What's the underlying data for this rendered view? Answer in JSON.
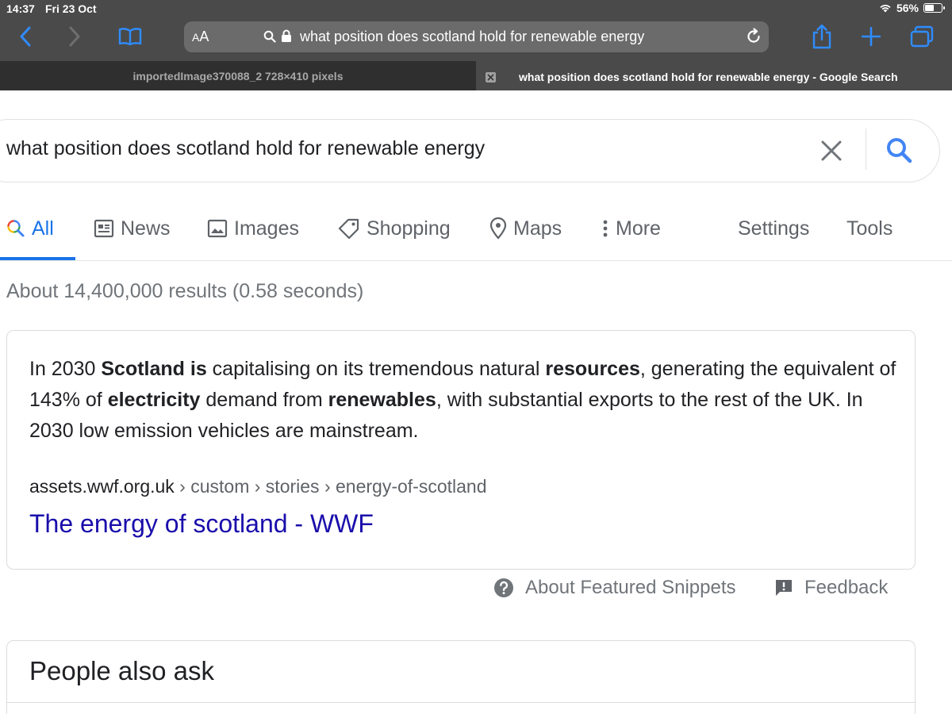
{
  "status": {
    "time": "14:37",
    "date": "Fri 23 Oct",
    "battery": "56%"
  },
  "safari": {
    "text_size_label": "AA",
    "url_text": "what position does scotland hold for renewable energy"
  },
  "tabs": [
    {
      "label": "importedImage370088_2 728×410 pixels",
      "active": false
    },
    {
      "label": "what position does scotland hold for renewable energy - Google Search",
      "active": true
    }
  ],
  "search": {
    "query": "what position does scotland hold for renewable energy"
  },
  "nav": {
    "all": "All",
    "news": "News",
    "images": "Images",
    "shopping": "Shopping",
    "maps": "Maps",
    "more": "More",
    "settings": "Settings",
    "tools": "Tools"
  },
  "result_stats": "About 14,400,000 results (0.58 seconds)",
  "snippet": {
    "parts": [
      {
        "text": "In 2030 ",
        "bold": false
      },
      {
        "text": "Scotland is",
        "bold": true
      },
      {
        "text": " capitalising on its tremendous natural ",
        "bold": false
      },
      {
        "text": "resources",
        "bold": true
      },
      {
        "text": ", generating the equivalent of 143% of ",
        "bold": false
      },
      {
        "text": "electricity",
        "bold": true
      },
      {
        "text": " demand from ",
        "bold": false
      },
      {
        "text": "renewables",
        "bold": true
      },
      {
        "text": ", with substantial exports to the rest of the UK. In 2030 low emission vehicles are mainstream.",
        "bold": false
      }
    ],
    "domain": "assets.wwf.org.uk",
    "path": " › custom › stories › energy-of-scotland",
    "link_title": "The energy of scotland - WWF"
  },
  "about_featured_snippets": "About Featured Snippets",
  "feedback": "Feedback",
  "people_also_ask": "People also ask",
  "colors": {
    "link": "#1a0dab",
    "accent": "#1a73e8",
    "chrome": "#4a4a4a"
  }
}
